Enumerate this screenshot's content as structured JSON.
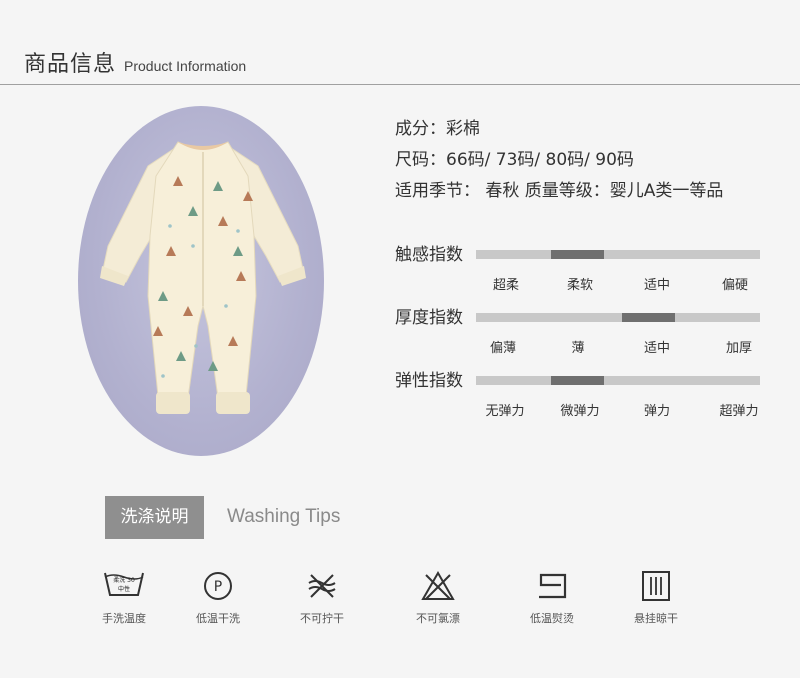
{
  "header": {
    "title_cn": "商品信息",
    "title_en": "Product Information"
  },
  "info": {
    "composition": "成分：彩棉",
    "sizes": "尺码：66码/ 73码/ 80码/ 90码",
    "season_quality": "适用季节：  春秋  质量等级：婴儿A类一等品"
  },
  "scales": [
    {
      "label": "触感指数",
      "ticks": [
        "超柔",
        "柔软",
        "适中",
        "偏硬"
      ],
      "selected_index": 1
    },
    {
      "label": "厚度指数",
      "ticks": [
        "偏薄",
        "薄",
        "适中",
        "加厚"
      ],
      "selected_index": 2
    },
    {
      "label": "弹性指数",
      "ticks": [
        "无弹力",
        "微弹力",
        "弹力",
        "超弹力"
      ],
      "selected_index": 1
    }
  ],
  "washing": {
    "tag_cn": "洗涤说明",
    "title_en": "Washing Tips",
    "items": [
      {
        "icon": "hand-wash-icon",
        "label": "手洗温度",
        "icon_text_top": "柔洗 30",
        "icon_text_bottom": "中性"
      },
      {
        "icon": "dry-clean-p-icon",
        "label": "低温干洗",
        "icon_text": "P"
      },
      {
        "icon": "do-not-wring-icon",
        "label": "不可拧干"
      },
      {
        "icon": "do-not-bleach-icon",
        "label": "不可氯漂"
      },
      {
        "icon": "iron-low-icon",
        "label": "低温熨烫"
      },
      {
        "icon": "line-dry-icon",
        "label": "悬挂晾干"
      }
    ]
  },
  "colors": {
    "background": "#f5f5f5",
    "bar": "#c8c8c8",
    "bar_fill": "#6f6f6f",
    "tag_bg": "#8f8f8f",
    "oval": "#b2b1cf"
  }
}
